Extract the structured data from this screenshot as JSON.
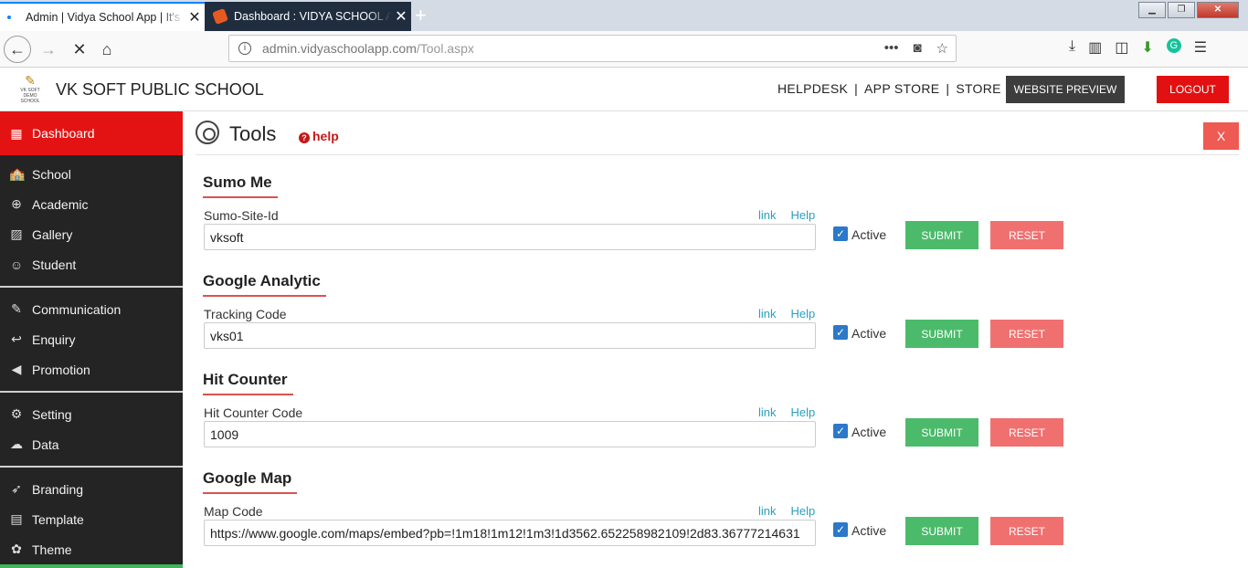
{
  "browser": {
    "tabs": [
      {
        "title": "Admin | Vidya School App | It's"
      },
      {
        "title": "Dashboard : VIDYA SCHOOL A"
      }
    ],
    "url_host": "admin.vidyaschoolapp.com",
    "url_path": "/Tool.aspx"
  },
  "header": {
    "logo_text": "VK SOFT",
    "logo_sub": "DEMO SCHOOL",
    "school_name": "VK SOFT PUBLIC SCHOOL",
    "links": [
      "HELPDESK",
      "APP STORE",
      "STORE"
    ],
    "preview_label": "WEBSITE PREVIEW",
    "logout_label": "LOGOUT"
  },
  "sidebar": {
    "active": {
      "label": "Dashboard",
      "icon": "dashboard-icon"
    },
    "items": [
      {
        "label": "School",
        "icon": "school-icon"
      },
      {
        "label": "Academic",
        "icon": "globe-icon"
      },
      {
        "label": "Gallery",
        "icon": "image-icon"
      },
      {
        "label": "Student",
        "icon": "student-icon"
      },
      {
        "label": "Communication",
        "icon": "megaphone-icon"
      },
      {
        "label": "Enquiry",
        "icon": "reply-icon"
      },
      {
        "label": "Promotion",
        "icon": "bullhorn-icon"
      },
      {
        "label": "Setting",
        "icon": "gear-icon"
      },
      {
        "label": "Data",
        "icon": "cloud-icon"
      },
      {
        "label": "Branding",
        "icon": "rocket-icon"
      },
      {
        "label": "Template",
        "icon": "layout-icon"
      },
      {
        "label": "Theme",
        "icon": "palette-icon"
      }
    ]
  },
  "page": {
    "title": "Tools",
    "help_label": "help",
    "close_label": "X"
  },
  "sections": [
    {
      "heading": "Sumo Me",
      "label": "Sumo-Site-Id",
      "value": "vksoft"
    },
    {
      "heading": "Google Analytic",
      "label": "Tracking Code",
      "value": "vks01"
    },
    {
      "heading": "Hit Counter",
      "label": "Hit Counter Code",
      "value": "1009"
    },
    {
      "heading": "Google Map",
      "label": "Map Code",
      "value": "https://www.google.com/maps/embed?pb=!1m18!1m12!1m3!1d3562.652258982109!2d83.36777214631"
    }
  ],
  "common": {
    "link_label": "link",
    "help_label": "Help",
    "active_label": "Active",
    "submit_label": "SUBMIT",
    "reset_label": "RESET"
  }
}
